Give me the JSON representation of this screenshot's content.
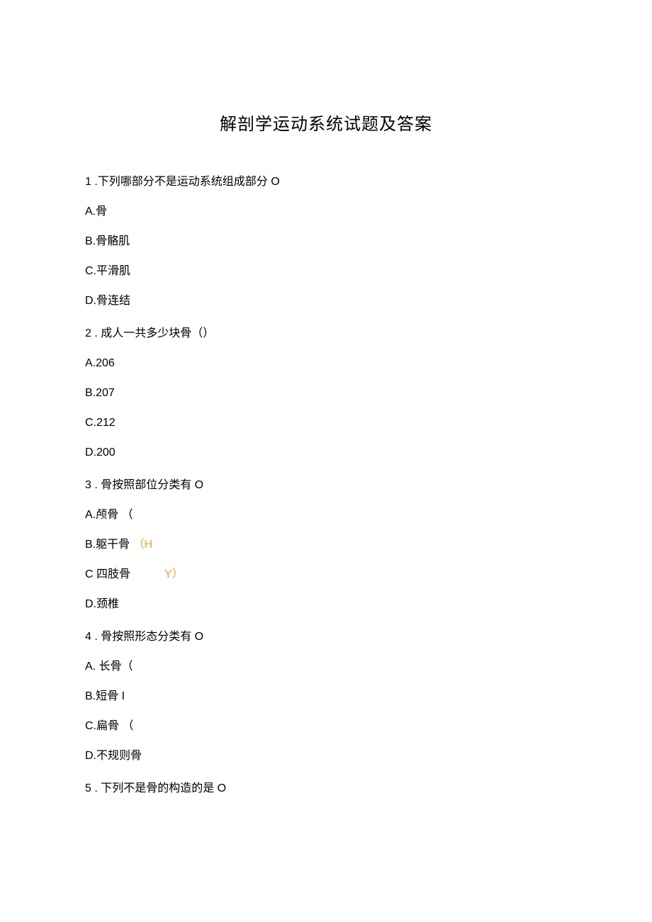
{
  "title": "解剖学运动系统试题及答案",
  "q1": {
    "stem": "1 .下列哪部分不是运动系统组成部分 O",
    "a": "A.骨",
    "b": "B.骨骼肌",
    "c": "C.平滑肌",
    "d": "D.骨连结"
  },
  "q2": {
    "stem": "2  . 成人一共多少块骨（）",
    "a": "A.206",
    "b": "B.207",
    "c": "C.212",
    "d": "D.200"
  },
  "q3": {
    "stem": "3  . 骨按照部位分类有 O",
    "a": "A.颅骨 （",
    "b_prefix": "B.躯干骨 ",
    "b_orange": "（H",
    "c_prefix": "C 四肢骨",
    "c_orange": "Y）",
    "d": "D.颈椎"
  },
  "q4": {
    "stem": "4  . 骨按照形态分类有 O",
    "a": "A. 长骨（",
    "b": "B.短骨 I",
    "c": "C.扁骨 （",
    "d": "D.不规则骨"
  },
  "q5": {
    "stem": "5  . 下列不是骨的构造的是 O"
  }
}
